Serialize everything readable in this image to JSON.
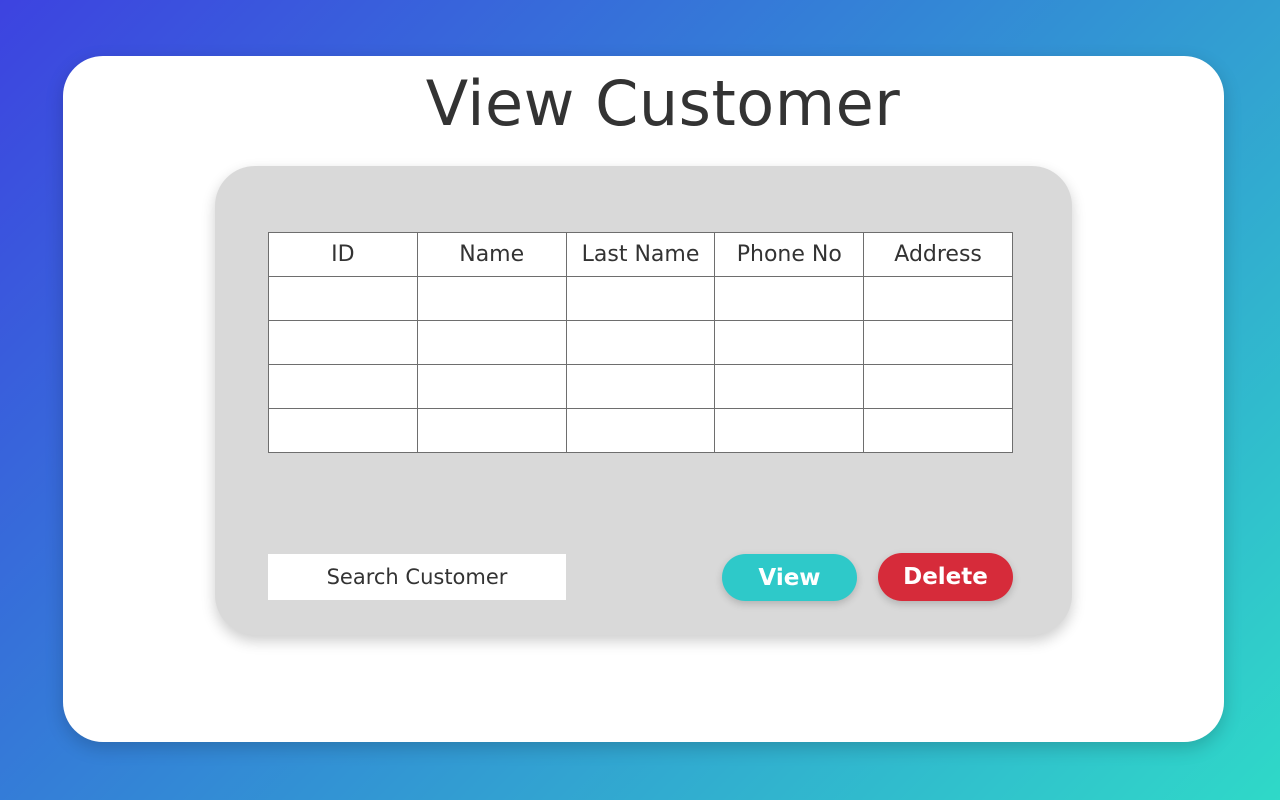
{
  "page": {
    "title": "View Customer"
  },
  "table": {
    "columns": [
      "ID",
      "Name",
      "Last Name",
      "Phone No",
      "Address"
    ],
    "rows": [
      [
        "",
        "",
        "",
        "",
        ""
      ],
      [
        "",
        "",
        "",
        "",
        ""
      ],
      [
        "",
        "",
        "",
        "",
        ""
      ],
      [
        "",
        "",
        "",
        "",
        ""
      ]
    ]
  },
  "search": {
    "placeholder": "Search Customer",
    "value": ""
  },
  "actions": {
    "view_label": "View",
    "delete_label": "Delete"
  },
  "colors": {
    "view_button": "#2ec9c9",
    "delete_button": "#d62b3a",
    "panel": "#d9d9d9",
    "card": "#ffffff"
  }
}
